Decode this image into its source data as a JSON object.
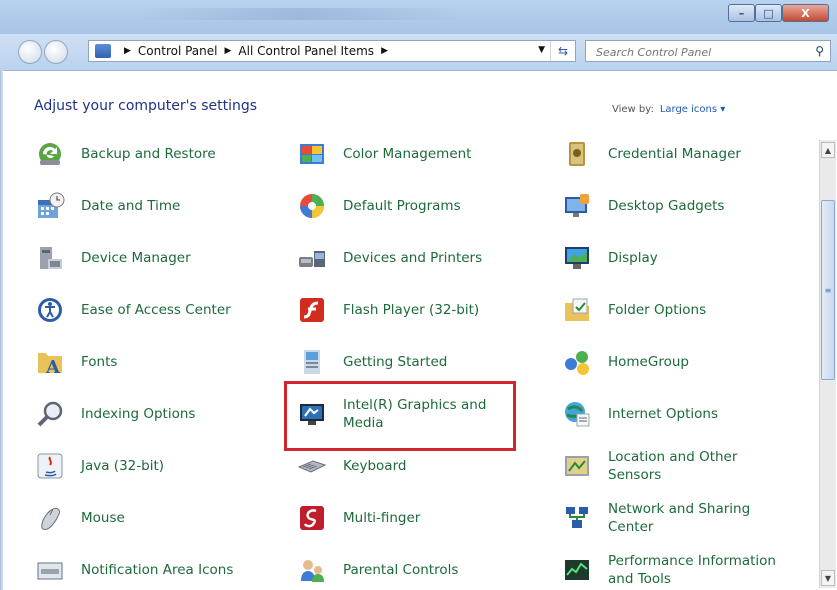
{
  "window": {
    "minimize_label": "–",
    "maximize_label": "□",
    "close_label": "X"
  },
  "address": {
    "segments": [
      "Control Panel",
      "All Control Panel Items"
    ]
  },
  "search": {
    "placeholder": "Search Control Panel"
  },
  "header": {
    "title": "Adjust your computer's settings",
    "view_by_label": "View by:",
    "view_by_value": "Large icons"
  },
  "items": [
    {
      "label": "Backup and Restore",
      "icon": "backup-restore-icon"
    },
    {
      "label": "Color Management",
      "icon": "color-management-icon"
    },
    {
      "label": "Credential Manager",
      "icon": "credential-manager-icon"
    },
    {
      "label": "Date and Time",
      "icon": "date-time-icon"
    },
    {
      "label": "Default Programs",
      "icon": "default-programs-icon"
    },
    {
      "label": "Desktop Gadgets",
      "icon": "desktop-gadgets-icon"
    },
    {
      "label": "Device Manager",
      "icon": "device-manager-icon"
    },
    {
      "label": "Devices and Printers",
      "icon": "devices-printers-icon"
    },
    {
      "label": "Display",
      "icon": "display-icon"
    },
    {
      "label": "Ease of Access Center",
      "icon": "ease-of-access-icon"
    },
    {
      "label": "Flash Player (32-bit)",
      "icon": "flash-player-icon"
    },
    {
      "label": "Folder Options",
      "icon": "folder-options-icon"
    },
    {
      "label": "Fonts",
      "icon": "fonts-icon"
    },
    {
      "label": "Getting Started",
      "icon": "getting-started-icon"
    },
    {
      "label": "HomeGroup",
      "icon": "homegroup-icon"
    },
    {
      "label": "Indexing Options",
      "icon": "indexing-options-icon"
    },
    {
      "label": "Intel(R) Graphics and Media",
      "icon": "intel-graphics-icon"
    },
    {
      "label": "Internet Options",
      "icon": "internet-options-icon"
    },
    {
      "label": "Java (32-bit)",
      "icon": "java-icon"
    },
    {
      "label": "Keyboard",
      "icon": "keyboard-icon"
    },
    {
      "label": "Location and Other Sensors",
      "icon": "location-sensors-icon"
    },
    {
      "label": "Mouse",
      "icon": "mouse-icon"
    },
    {
      "label": "Multi-finger",
      "icon": "multi-finger-icon"
    },
    {
      "label": "Network and Sharing Center",
      "icon": "network-sharing-icon"
    },
    {
      "label": "Notification Area Icons",
      "icon": "notification-area-icon"
    },
    {
      "label": "Parental Controls",
      "icon": "parental-controls-icon"
    },
    {
      "label": "Performance Information and Tools",
      "icon": "performance-info-icon"
    }
  ],
  "colors": {
    "link_green": "#1d6a3a",
    "title_blue": "#1e3287",
    "highlight_red": "#d0272f"
  }
}
